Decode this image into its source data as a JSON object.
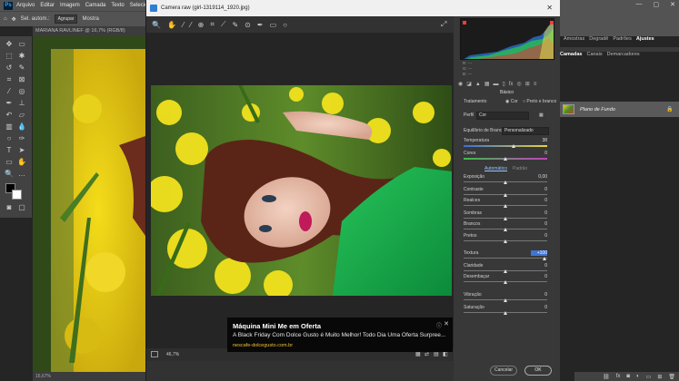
{
  "menubar": {
    "items": [
      "Arquivo",
      "Editar",
      "Imagem",
      "Camada",
      "Texto",
      "Selecion"
    ]
  },
  "options": {
    "tolerance": "Sel. autom.:",
    "layer_select": "Agrupar",
    "show": "Mostra"
  },
  "document": {
    "tab": "MARIANA RAVLINEF @ 16,7% (RGB/8)",
    "status": "16,67%"
  },
  "camera_raw": {
    "title": "Camera raw (girl-1319114_1920.jpg)",
    "zoom": "46,7%",
    "cancel": "Cancelar",
    "ok": "OK",
    "section": "Básico",
    "treatment_label": "Tratamento",
    "treatment_color": "Cor",
    "treatment_bw": "Preto e branco",
    "profile_label": "Perfil",
    "profile_value": "Cor",
    "wb_label": "Equilíbrio de Branco:",
    "wb_value": "Personalizado",
    "tone_auto": "Automático",
    "tone_default": "Padrão",
    "sliders": [
      {
        "label": "Temperatura",
        "value": "38",
        "pos": 0.6
      },
      {
        "label": "Cores",
        "value": "0",
        "pos": 0.5
      },
      {
        "label": "Exposição",
        "value": "0,00",
        "pos": 0.5
      },
      {
        "label": "Contraste",
        "value": "0",
        "pos": 0.5
      },
      {
        "label": "Realces",
        "value": "0",
        "pos": 0.5
      },
      {
        "label": "Sombras",
        "value": "0",
        "pos": 0.5
      },
      {
        "label": "Brancos",
        "value": "0",
        "pos": 0.5
      },
      {
        "label": "Pretos",
        "value": "0",
        "pos": 0.5
      },
      {
        "label": "Textura",
        "value": "+100",
        "pos": 0.97
      },
      {
        "label": "Claridade",
        "value": "0",
        "pos": 0.5
      },
      {
        "label": "Desembaçar",
        "value": "0",
        "pos": 0.5
      },
      {
        "label": "Vibração",
        "value": "0",
        "pos": 0.5
      },
      {
        "label": "Saturação",
        "value": "0",
        "pos": 0.5
      }
    ]
  },
  "ad": {
    "title": "Máquina Mini Me em Oferta",
    "text": "A Black Friday Com Dolce Gusto é Muito Melhor! Todo Dia Uma Oferta Surpree...",
    "url": "nescafe-dolcegusto.com.br"
  },
  "ps_panels": {
    "top_tabs": [
      "Amostras",
      "Degradê",
      "Padrões",
      "Ajustes"
    ],
    "layer_tabs": [
      "Camadas",
      "Canais",
      "Demarcadores"
    ],
    "layer_name": "Plano de Fundo"
  },
  "colors": {
    "accent": "#31a8ff",
    "ad_url": "#f1c232"
  }
}
